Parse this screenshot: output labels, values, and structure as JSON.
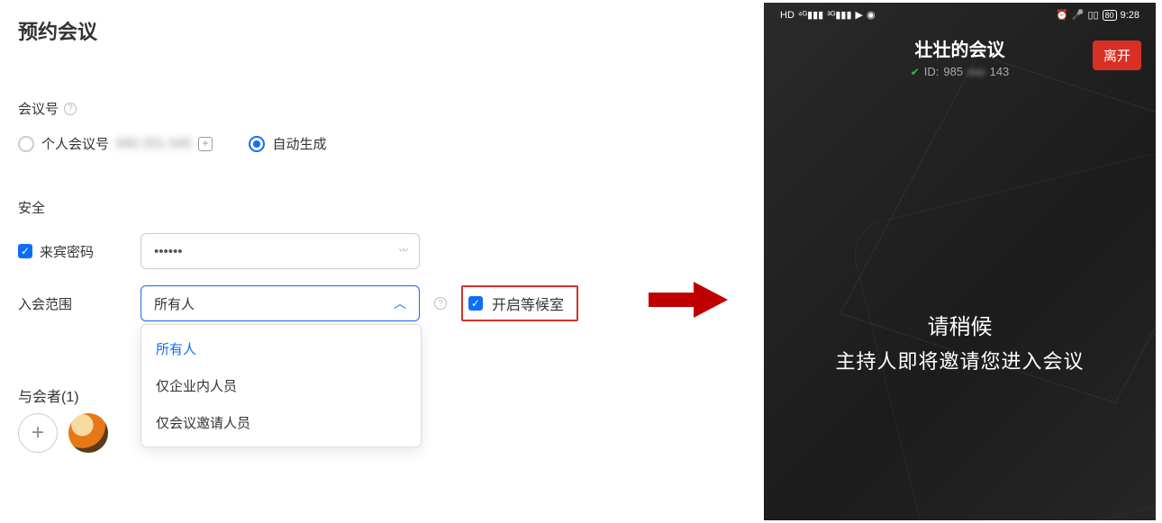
{
  "left": {
    "title": "预约会议",
    "meeting_id_label": "会议号",
    "personal_option": "个人会议号",
    "personal_number_blurred": "990 251 045",
    "auto_option": "自动生成",
    "security_label": "安全",
    "guest_pw_label": "来宾密码",
    "guest_pw_value": "••••••",
    "scope_label": "入会范围",
    "scope_selected": "所有人",
    "scope_options": [
      "所有人",
      "仅企业内人员",
      "仅会议邀请人员"
    ],
    "waiting_room_label": "开启等候室",
    "participants_label": "与会者(1)"
  },
  "phone": {
    "status_left_icons": [
      "HD",
      "4G",
      "3G",
      "▶",
      "👤"
    ],
    "status_time": "9:28",
    "status_battery": "80",
    "meeting_title": "壮壮的会议",
    "id_prefix": "ID:",
    "id_part1": "985",
    "id_part_blur": "xxx",
    "id_part3": "143",
    "leave": "离开",
    "wait_line1": "请稍候",
    "wait_line2": "主持人即将邀请您进入会议"
  }
}
